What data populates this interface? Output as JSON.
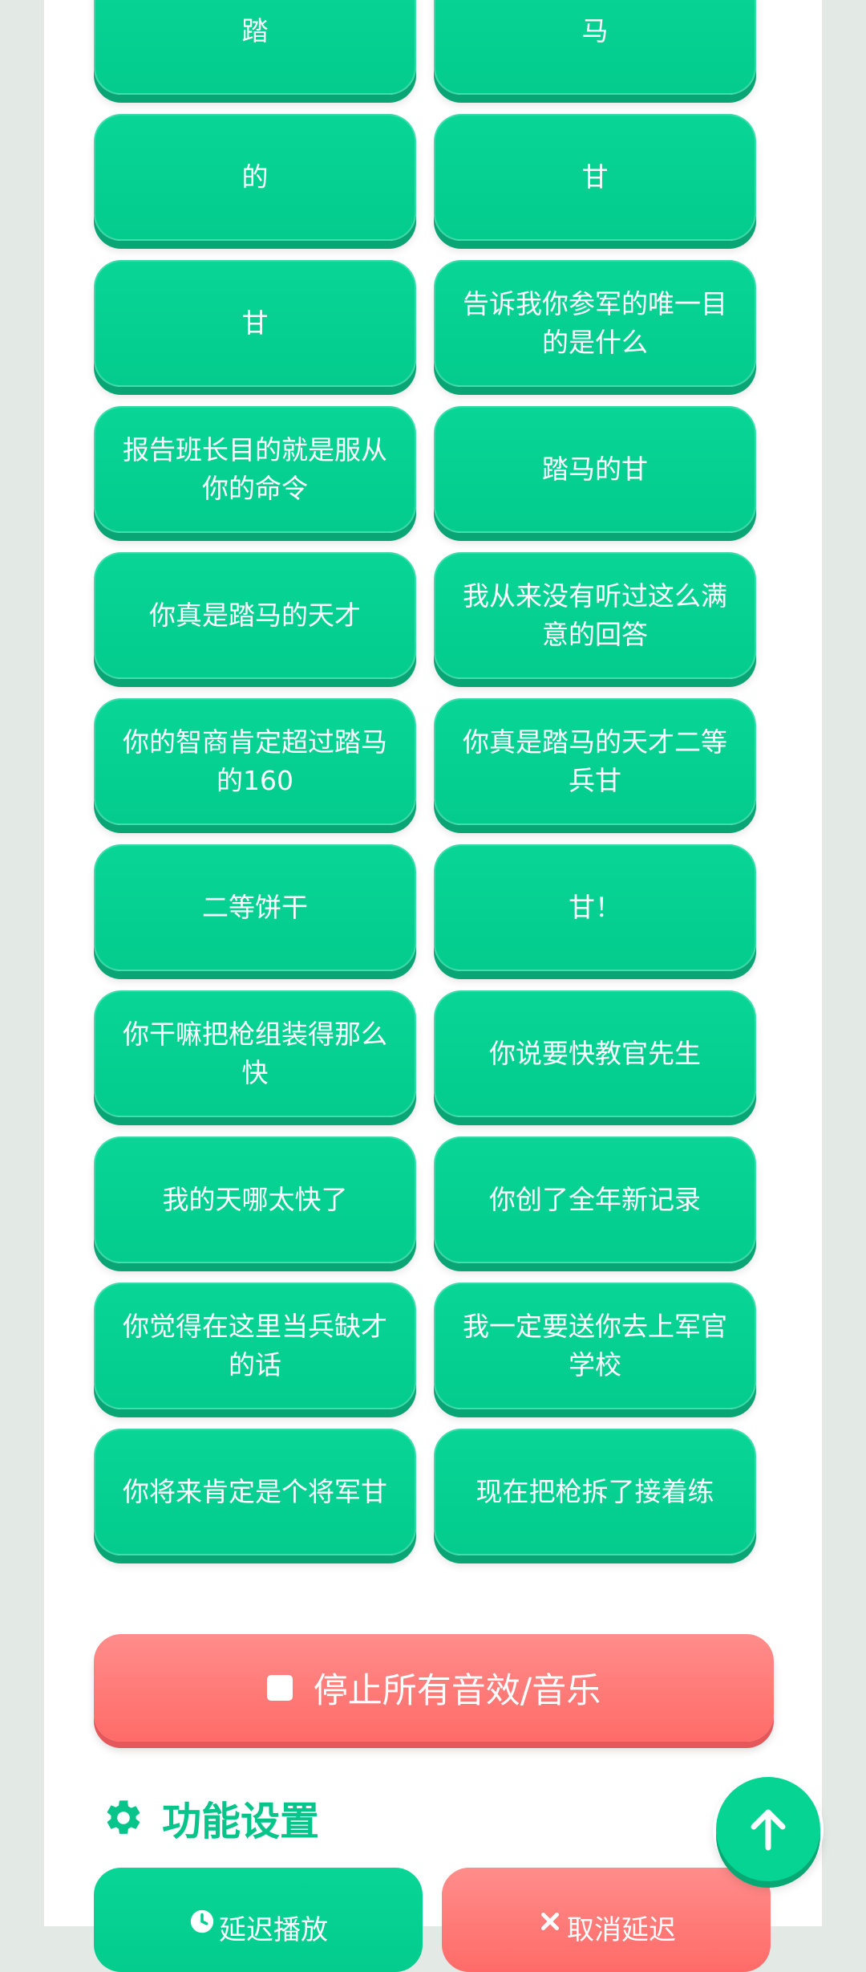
{
  "sounds": [
    "踏",
    "马",
    "的",
    "甘",
    "甘",
    "告诉我你参军的唯一目的是什么",
    "报告班长目的就是服从你的命令",
    "踏马的甘",
    "你真是踏马的天才",
    "我从来没有听过这么满意的回答",
    "你的智商肯定超过踏马的160",
    "你真是踏马的天才二等兵甘",
    "二等饼干",
    "甘！",
    "你干嘛把枪组装得那么快",
    "你说要快教官先生",
    "我的天哪太快了",
    "你创了全年新记录",
    "你觉得在这里当兵缺才的话",
    "我一定要送你去上军官学校",
    "你将来肯定是个将军甘",
    "现在把枪拆了接着练"
  ],
  "stop_button": {
    "label": "停止所有音效/音乐"
  },
  "settings": {
    "title": "功能设置",
    "delay_label": "延迟播放",
    "cancel_label": "取消延迟"
  },
  "colors": {
    "primary": "#03cc8d",
    "danger": "#ff6b68",
    "title": "#07c58a"
  }
}
